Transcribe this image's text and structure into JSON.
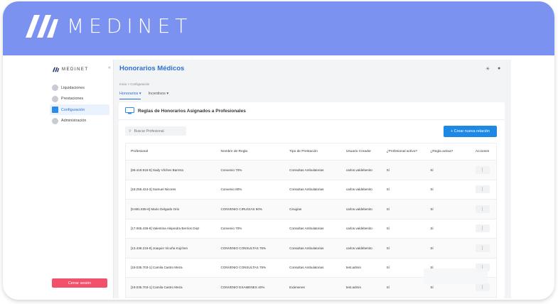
{
  "brand": {
    "name": "MEDINET"
  },
  "sidebar": {
    "logo_text": "MEDINET",
    "collapse_glyph": "«",
    "items": [
      {
        "label": "Liquidaciones",
        "icon": "receipt-icon"
      },
      {
        "label": "Prestaciones",
        "icon": "plus-box-icon"
      },
      {
        "label": "Configuración",
        "icon": "monitor-icon",
        "active": true
      },
      {
        "label": "Administración",
        "icon": "gear-icon"
      }
    ],
    "logout_label": "Cerrar sesión"
  },
  "header": {
    "title": "Honorarios Médicos",
    "icons": [
      "sun-icon",
      "user-icon"
    ]
  },
  "breadcrumb": "Inicio  >  Configuración",
  "tabs": [
    {
      "label": "Honorarios ▾",
      "active": true
    },
    {
      "label": "Incentivos ▾",
      "active": false
    }
  ],
  "card": {
    "title": "Reglas de Honorarios Asignados a Profesionales",
    "search_placeholder": "Buscar Profesional",
    "create_button": "+   Crear nueva relación"
  },
  "table": {
    "columns": [
      "Profesional",
      "Nombre de Regla",
      "Tipo de Prestación",
      "Usuario Creador",
      "¿Profesional activo?",
      "¿Regla activa?",
      "Acciones"
    ],
    "rows": [
      [
        "[69.419.915-5] Sady Vilches Barrera",
        "Convenio 70%",
        "Consultas Ambulatorias",
        "carlos.valdebenito",
        "Sí",
        "Sí"
      ],
      [
        "[18.255.424-3] Samuel Nicores",
        "Convenio 80%",
        "Consultas Ambulatorias",
        "carlos.valdebenito",
        "Sí",
        "Sí"
      ],
      [
        "[9.691.835-6] Mario Delgado Orio",
        "CONVENIO CIRUGIAS 90%",
        "Cirugías",
        "carlos.valdebenito",
        "Sí",
        "Sí"
      ],
      [
        "[17.065.436-9] Valentina Alejandra Berrios Diaz",
        "Convenio 70%",
        "Consultas Ambulatorias",
        "carlos.valdebenito",
        "Sí",
        "Sí"
      ],
      [
        "[13.436.216-9] Joaquin Vicuña Kojchen",
        "CONVENIO CONSULTAS 75%",
        "Consultas Ambulatorias",
        "carlos.valdebenito",
        "Sí",
        "Sí"
      ],
      [
        "[19.035.703-1] Camila Castro Meza",
        "CONVENIO CONSULTAS 75%",
        "Consultas Ambulatorias",
        "test.admin",
        "Sí",
        "Sí"
      ],
      [
        "[19.035.703-1] Camila Castro Meza",
        "CONVENIO EXAMENES 40%",
        "Exámenes",
        "test.admin",
        "Sí",
        "Sí"
      ]
    ],
    "action_glyph": "⋮"
  },
  "colors": {
    "banner": "#7b92f0",
    "accent": "#1e88e5",
    "logout": "#f2506b"
  }
}
